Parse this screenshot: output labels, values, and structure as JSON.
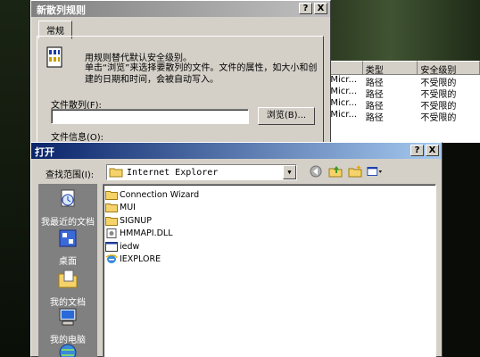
{
  "rule_dialog": {
    "title": "新散列规则",
    "help_btn": "?",
    "close_btn": "X",
    "tab": "常规",
    "desc_line1": "用规则替代默认安全级别。",
    "desc_line2": "单击“浏览”来选择要散列的文件。文件的属性，如大小和创建的日期和时间，会被自动写入。",
    "path_label": "文件散列(F):",
    "path_value": "",
    "browse_label": "浏览(B)...",
    "info_label": "文件信息(O):"
  },
  "bg_list": {
    "headers": [
      "",
      "类型",
      "安全级别"
    ],
    "rows": [
      {
        "name": "¥Micr...",
        "type": "路径",
        "level": "不受限的"
      },
      {
        "name": "¥Micr...",
        "type": "路径",
        "level": "不受限的"
      },
      {
        "name": "¥Micr...",
        "type": "路径",
        "level": "不受限的"
      },
      {
        "name": "¥Micr...",
        "type": "路径",
        "level": "不受限的"
      }
    ]
  },
  "open_dialog": {
    "title": "打开",
    "help_btn": "?",
    "close_btn": "X",
    "lookin_label": "查找范围(I):",
    "lookin_value": "Internet Explorer",
    "places": [
      {
        "label": "我最近的文档",
        "icon": "recent-docs-icon"
      },
      {
        "label": "桌面",
        "icon": "desktop-icon"
      },
      {
        "label": "我的文档",
        "icon": "my-documents-icon"
      },
      {
        "label": "我的电脑",
        "icon": "my-computer-icon"
      }
    ],
    "files": [
      {
        "name": "Connection Wizard",
        "icon": "folder-icon"
      },
      {
        "name": "MUI",
        "icon": "folder-icon"
      },
      {
        "name": "SIGNUP",
        "icon": "folder-icon"
      },
      {
        "name": "HMMAPI.DLL",
        "icon": "dll-file-icon"
      },
      {
        "name": "iedw",
        "icon": "exe-file-icon"
      },
      {
        "name": "IEXPLORE",
        "icon": "ie-icon"
      }
    ]
  }
}
